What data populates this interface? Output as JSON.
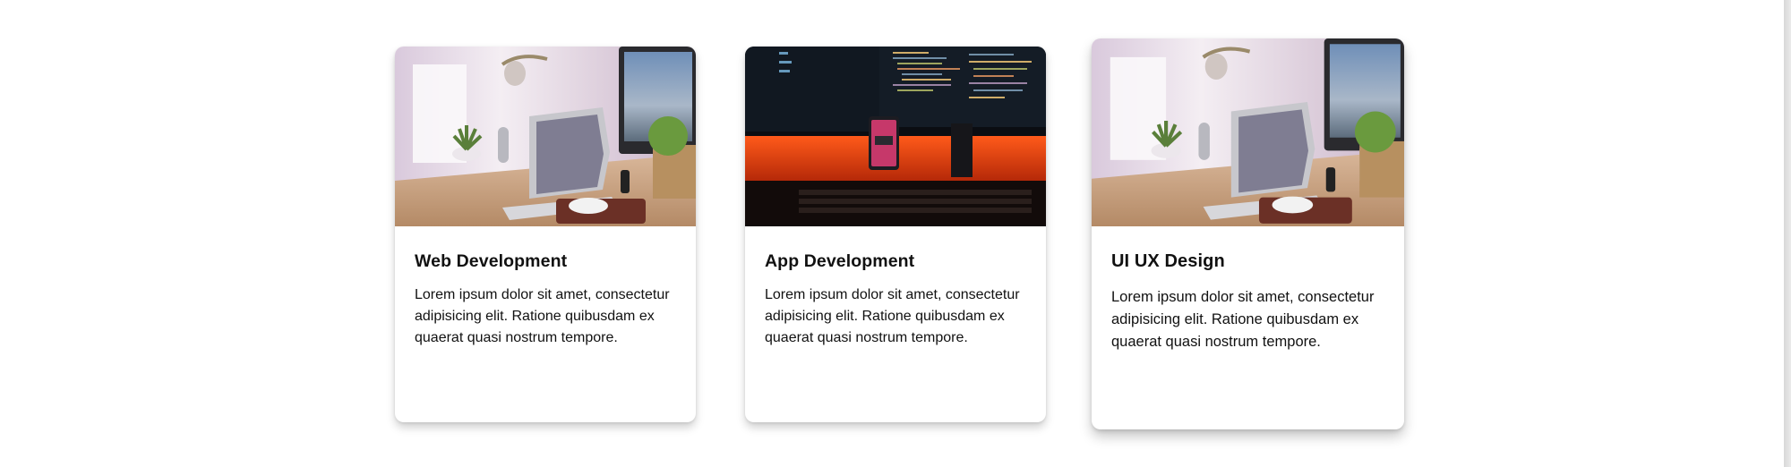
{
  "cards": [
    {
      "image": "desk-laptop-photo",
      "title": "Web Development",
      "text": "Lorem ipsum dolor sit amet, consectetur adipisicing elit. Ratione quibusdam ex quaerat quasi nostrum tempore."
    },
    {
      "image": "dark-code-monitors-photo",
      "title": "App Development",
      "text": "Lorem ipsum dolor sit amet, consectetur adipisicing elit. Ratione quibusdam ex quaerat quasi nostrum tempore."
    },
    {
      "image": "desk-laptop-photo",
      "title": "UI UX Design",
      "text": "Lorem ipsum dolor sit amet, consectetur adipisicing elit. Ratione quibusdam ex quaerat quasi nostrum tempore."
    }
  ],
  "colors": {
    "background": "#ffffff",
    "text": "#111111",
    "card_shadow": "rgba(0,0,0,0.18)"
  }
}
